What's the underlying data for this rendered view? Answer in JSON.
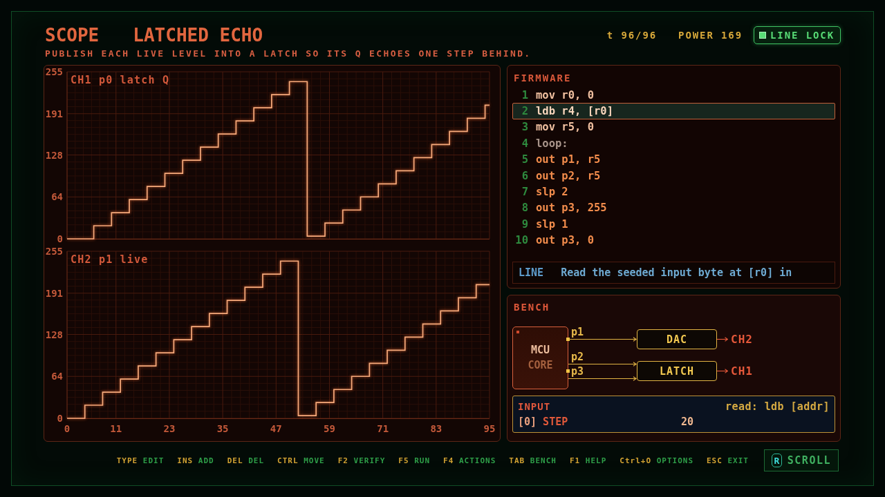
{
  "header": {
    "app_name": "SCOPE",
    "title": "LATCHED ECHO",
    "description": "PUBLISH EACH LIVE LEVEL INTO A LATCH SO ITS Q ECHOES ONE STEP BEHIND.",
    "stats": [
      "t 96/96",
      "POWER 169"
    ],
    "line_lock": {
      "label": "LINE LOCK",
      "on": true
    }
  },
  "scope": {
    "charts": [
      {
        "chart_data": {
          "type": "line",
          "title": "CH1 p0 latch Q",
          "grid": true,
          "xlim": [
            0,
            95
          ],
          "ylim": [
            0,
            255
          ],
          "yticks": [
            0,
            64,
            128,
            191,
            255
          ],
          "x": [
            0,
            6,
            6,
            10,
            10,
            14,
            14,
            18,
            18,
            22,
            22,
            26,
            26,
            30,
            30,
            34,
            34,
            38,
            38,
            42,
            42,
            46,
            46,
            50,
            50,
            54,
            54,
            58,
            58,
            62,
            62,
            66,
            66,
            70,
            70,
            74,
            74,
            78,
            78,
            82,
            82,
            86,
            86,
            90,
            90,
            94,
            94,
            95
          ],
          "values": [
            0,
            0,
            20,
            20,
            40,
            40,
            60,
            60,
            80,
            80,
            100,
            100,
            120,
            120,
            140,
            140,
            160,
            160,
            180,
            180,
            200,
            200,
            220,
            220,
            240,
            240,
            4,
            4,
            24,
            24,
            44,
            44,
            64,
            64,
            84,
            84,
            104,
            104,
            124,
            124,
            144,
            144,
            164,
            164,
            184,
            184,
            204,
            204
          ]
        }
      },
      {
        "chart_data": {
          "type": "line",
          "title": "CH2 p1 live",
          "grid": true,
          "xlim": [
            0,
            95
          ],
          "ylim": [
            0,
            255
          ],
          "xticks": [
            0,
            11,
            23,
            35,
            47,
            59,
            71,
            83,
            95
          ],
          "yticks": [
            0,
            64,
            128,
            191,
            255
          ],
          "x": [
            0,
            4,
            4,
            8,
            8,
            12,
            12,
            16,
            16,
            20,
            20,
            24,
            24,
            28,
            28,
            32,
            32,
            36,
            36,
            40,
            40,
            44,
            44,
            48,
            48,
            52,
            52,
            56,
            56,
            60,
            60,
            64,
            64,
            68,
            68,
            72,
            72,
            76,
            76,
            80,
            80,
            84,
            84,
            88,
            88,
            92,
            92,
            95
          ],
          "values": [
            0,
            0,
            20,
            20,
            40,
            40,
            60,
            60,
            80,
            80,
            100,
            100,
            120,
            120,
            140,
            140,
            160,
            160,
            180,
            180,
            200,
            200,
            220,
            220,
            240,
            240,
            4,
            4,
            24,
            24,
            44,
            44,
            64,
            64,
            84,
            84,
            104,
            104,
            124,
            124,
            144,
            144,
            164,
            164,
            184,
            184,
            204,
            204
          ]
        }
      }
    ]
  },
  "firmware": {
    "title": "FIRMWARE",
    "lines": [
      {
        "number": "1",
        "code": "mov r0, 0",
        "kind": "setup",
        "selected": false
      },
      {
        "number": "2",
        "code": "ldb r4, [r0]",
        "kind": "setup",
        "selected": true
      },
      {
        "number": "3",
        "code": "mov r5, 0",
        "kind": "setup",
        "selected": false
      },
      {
        "number": "4",
        "code": "loop:",
        "kind": "label",
        "selected": false
      },
      {
        "number": "5",
        "code": "out p1, r5",
        "kind": "loop",
        "selected": false
      },
      {
        "number": "6",
        "code": "out p2, r5",
        "kind": "loop",
        "selected": false
      },
      {
        "number": "7",
        "code": "slp 2",
        "kind": "loop",
        "selected": false
      },
      {
        "number": "8",
        "code": "out p3, 255",
        "kind": "loop",
        "selected": false
      },
      {
        "number": "9",
        "code": "slp 1",
        "kind": "loop",
        "selected": false
      },
      {
        "number": "10",
        "code": "out p3, 0",
        "kind": "loop",
        "selected": false
      }
    ],
    "line_help": {
      "label": "LINE",
      "text": "Read the seeded input byte at [r0] in"
    }
  },
  "bench": {
    "title": "BENCH",
    "mcu": {
      "name": "MCU",
      "subtitle": "CORE"
    },
    "devices": [
      {
        "label": "DAC",
        "inputs": [
          "p1"
        ],
        "output": "CH2"
      },
      {
        "label": "LATCH",
        "inputs": [
          "p2",
          "p3"
        ],
        "output": "CH1"
      }
    ],
    "input": {
      "title": "INPUT",
      "hint": "read: ldb [addr]",
      "rows": [
        {
          "address": "[0]",
          "name": "STEP",
          "value": "20"
        }
      ]
    }
  },
  "key_hints": [
    {
      "key": "TYPE",
      "action": "EDIT"
    },
    {
      "key": "INS",
      "action": "ADD"
    },
    {
      "key": "DEL",
      "action": "DEL"
    },
    {
      "key": "CTRL",
      "action": "MOVE"
    },
    {
      "key": "F2",
      "action": "VERIFY"
    },
    {
      "key": "F5",
      "action": "RUN"
    },
    {
      "key": "F4",
      "action": "ACTIONS"
    },
    {
      "key": "TAB",
      "action": "BENCH"
    },
    {
      "key": "F1",
      "action": "HELP"
    },
    {
      "key": "Ctrl+O",
      "action": "OPTIONS"
    },
    {
      "key": "ESC",
      "action": "EXIT"
    }
  ],
  "scroll_button": {
    "key": "R",
    "label": "SCROLL"
  }
}
